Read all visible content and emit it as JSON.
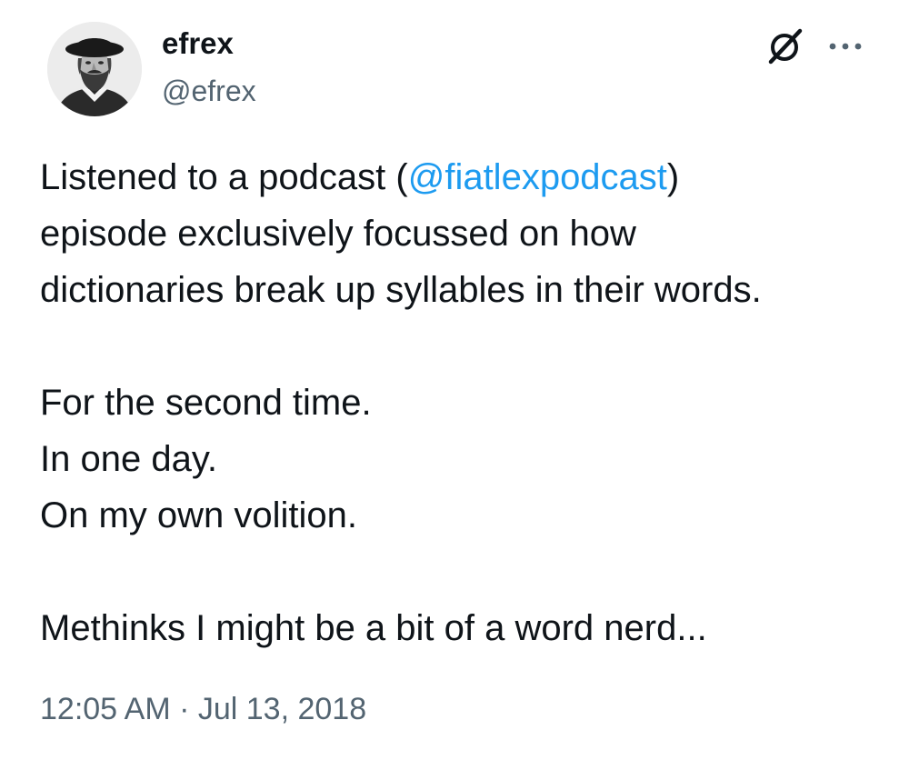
{
  "author": {
    "display_name": "efrex",
    "handle": "@efrex",
    "avatar_icon": "engraved-portrait-avatar"
  },
  "header_actions": {
    "grok_icon": "grok-icon",
    "more_icon": "more-options-icon"
  },
  "tweet": {
    "line1_before": "Listened to a podcast (",
    "mention": "@fiatlexpodcast",
    "line1_after": ")",
    "line2": "episode exclusively focussed on how",
    "line3": "dictionaries break up syllables in their words.",
    "line4": "For the second time.",
    "line5": "In one day.",
    "line6": "On my own volition.",
    "line7": "Methinks I might be a bit of a word nerd..."
  },
  "meta": {
    "timestamp": "12:05 AM · Jul 13, 2018"
  },
  "colors": {
    "text": "#0f1419",
    "secondary": "#536471",
    "link": "#1d9bf0",
    "background": "#ffffff"
  }
}
